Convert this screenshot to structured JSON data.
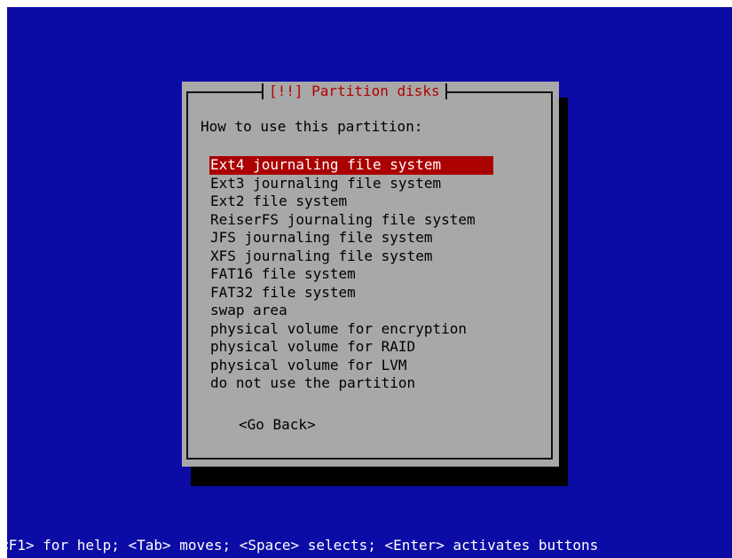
{
  "dialog": {
    "title": "[!!] Partition disks",
    "prompt": "How to use this partition:",
    "options": [
      "Ext4 journaling file system",
      "Ext3 journaling file system",
      "Ext2 file system",
      "ReiserFS journaling file system",
      "JFS journaling file system",
      "XFS journaling file system",
      "FAT16 file system",
      "FAT32 file system",
      "swap area",
      "physical volume for encryption",
      "physical volume for RAID",
      "physical volume for LVM",
      "do not use the partition"
    ],
    "selected_index": 0,
    "go_back_label": "<Go Back>"
  },
  "status_bar": {
    "text": "<F1> for help; <Tab> moves; <Space> selects; <Enter> activates buttons"
  },
  "colors": {
    "background": "#0b0ba6",
    "dialog": "#a8a8a8",
    "title": "#b50000",
    "highlight": "#aa0000"
  }
}
